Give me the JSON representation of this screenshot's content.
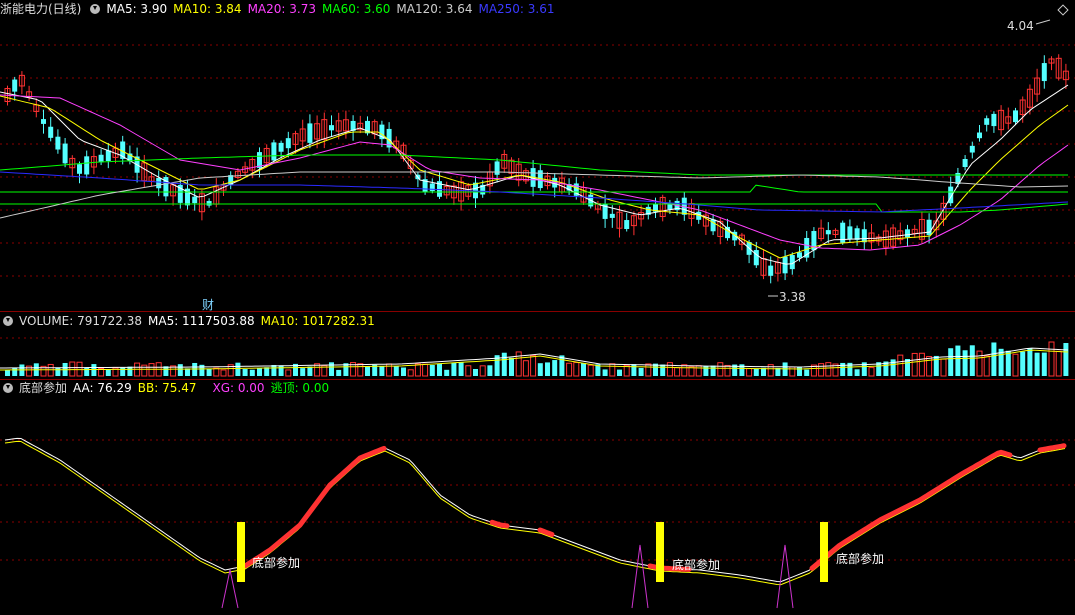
{
  "price_header": {
    "title": "浙能电力(日线)",
    "ma5": "MA5: 3.90",
    "ma10": "MA10: 3.84",
    "ma20": "MA20: 3.73",
    "ma60": "MA60: 3.60",
    "ma120": "MA120: 3.64",
    "ma250": "MA250: 3.61"
  },
  "price_annotations": {
    "high": "4.04",
    "low": "3.38",
    "fin_marker": "财"
  },
  "volume_header": {
    "label": "VOLUME: 791722.38",
    "ma5": "MA5: 1117503.88",
    "ma10": "MA10: 1017282.31"
  },
  "indicator_header": {
    "name": "底部参加",
    "aa": "AA: 76.29",
    "bb": "BB: 75.47",
    "xg": "XG: 0.00",
    "escape": "逃顶: 0.00"
  },
  "indicator_annotations": {
    "signal_label": "底部参加"
  },
  "colors": {
    "up": "#ff3232",
    "down": "#54ffff",
    "ma5": "#ffffff",
    "ma10": "#ffff00",
    "ma20": "#ff40ff",
    "ma60": "#00ff00",
    "ma120": "#cccccc",
    "ma250": "#2a2aff",
    "grid": "#8a0000",
    "signal": "#ffff00",
    "spike": "#cc33cc"
  },
  "chart_data": {
    "type": "candlestick",
    "price_range": [
      3.3,
      4.1
    ],
    "high_marker": 4.04,
    "low_marker": 3.38,
    "indicator_signals": [
      3,
      2,
      3
    ]
  }
}
